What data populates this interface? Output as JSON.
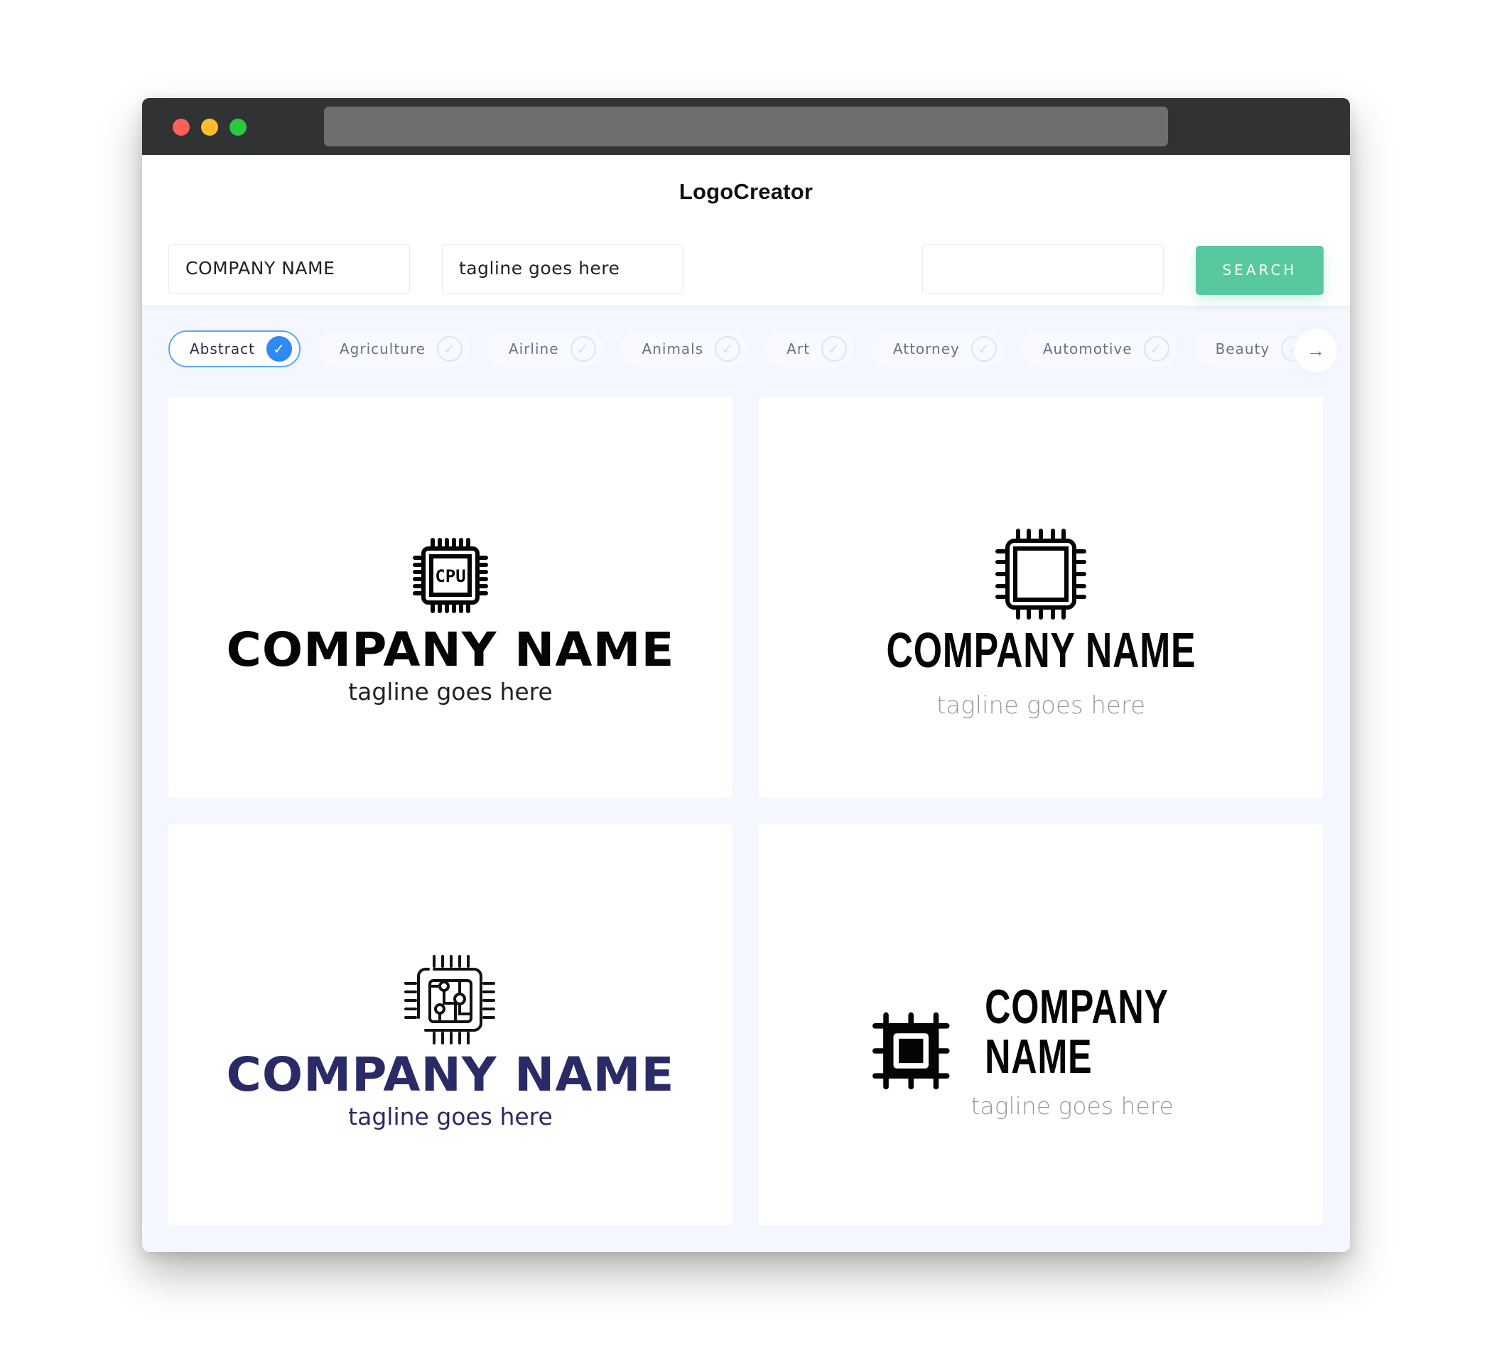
{
  "app": {
    "title": "LogoCreator"
  },
  "inputs": {
    "company_name": "COMPANY NAME",
    "tagline": "tagline goes here",
    "extra": "",
    "search_label": "SEARCH"
  },
  "filters": {
    "items": [
      {
        "label": "Abstract",
        "selected": true
      },
      {
        "label": "Agriculture",
        "selected": false
      },
      {
        "label": "Airline",
        "selected": false
      },
      {
        "label": "Animals",
        "selected": false
      },
      {
        "label": "Art",
        "selected": false
      },
      {
        "label": "Attorney",
        "selected": false
      },
      {
        "label": "Automotive",
        "selected": false
      },
      {
        "label": "Beauty",
        "selected": false
      }
    ],
    "next_icon": "arrow-right-icon",
    "check_icon": "check-icon"
  },
  "colors": {
    "accent_blue": "#2f8af2",
    "search_green": "#58c89e",
    "navy": "#2a2b66"
  },
  "logos": [
    {
      "icon": "cpu-chip-labeled-icon",
      "icon_text": "CPU",
      "company": "COMPANY NAME",
      "tagline": "tagline goes here",
      "color": "#050505"
    },
    {
      "icon": "chip-outline-icon",
      "company": "COMPANY NAME",
      "tagline": "tagline goes here",
      "color": "#050505"
    },
    {
      "icon": "circuit-chip-icon",
      "company": "COMPANY NAME",
      "tagline": "tagline goes here",
      "color": "#2a2b66"
    },
    {
      "icon": "solid-chip-icon",
      "company": "COMPANY NAME",
      "tagline": "tagline goes here",
      "color": "#050505"
    }
  ]
}
